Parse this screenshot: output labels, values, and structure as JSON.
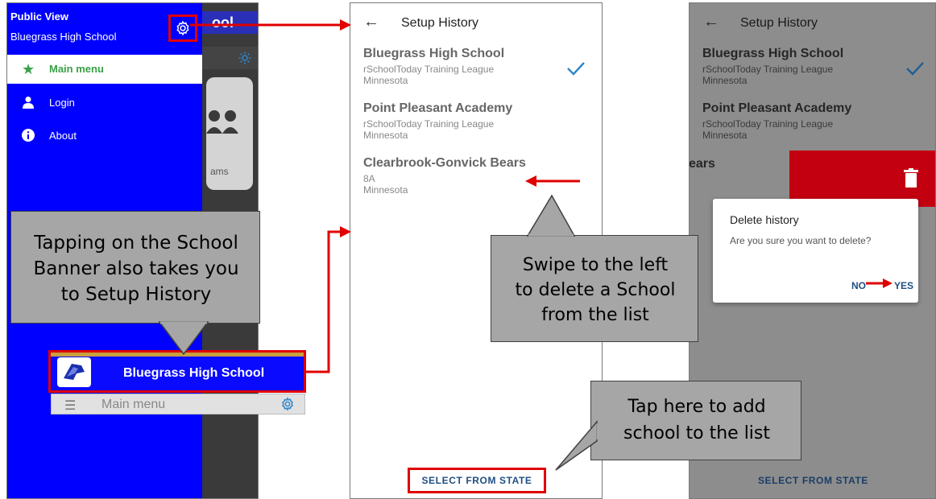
{
  "drawer": {
    "header_title": "Public View",
    "school_name": "Bluegrass High School",
    "bg_bar_text": "ool",
    "bg_card_text": "ams",
    "menu": [
      {
        "label": "Main menu",
        "icon": "star-icon"
      },
      {
        "label": "Login",
        "icon": "person-icon"
      },
      {
        "label": "About",
        "icon": "info-icon"
      }
    ]
  },
  "banner": {
    "school_name": "Bluegrass High School"
  },
  "bottom_bar": {
    "label": "Main menu"
  },
  "setup_history": {
    "title": "Setup History",
    "schools": [
      {
        "name": "Bluegrass High School",
        "league": "rSchoolToday Training League",
        "state": "Minnesota",
        "selected": true
      },
      {
        "name": "Point Pleasant Academy",
        "league": "rSchoolToday Training League",
        "state": "Minnesota",
        "selected": false
      },
      {
        "name": "Clearbrook-Gonvick Bears",
        "league": "8A",
        "state": "Minnesota",
        "selected": false
      }
    ],
    "select_button": "SELECT FROM STATE"
  },
  "delete_panel": {
    "title": "Setup History",
    "schools": [
      {
        "name": "Bluegrass High School",
        "league": "rSchoolToday Training League",
        "state": "Minnesota"
      },
      {
        "name": "Point Pleasant Academy",
        "league": "rSchoolToday Training League",
        "state": "Minnesota"
      }
    ],
    "partial_name": "ears",
    "dialog": {
      "title": "Delete history",
      "message": "Are you sure you want to delete?",
      "no": "NO",
      "yes": "YES"
    },
    "select_button": "SELECT FROM STATE"
  },
  "callouts": {
    "banner_tip": [
      "Tapping on the School",
      "Banner also takes you",
      "to Setup History"
    ],
    "swipe_tip": [
      "Swipe to the left",
      "to delete a School",
      "from the list"
    ],
    "add_tip": [
      "Tap here to add",
      "school to the list"
    ]
  },
  "colors": {
    "drawer_blue": "#0000ff",
    "highlight_red": "#e00000",
    "accent_green": "#3aa048",
    "link_blue": "#1f4e82",
    "check_blue": "#2f86c9",
    "delete_red": "#c30010",
    "callout_grey": "#a6a6a6"
  }
}
